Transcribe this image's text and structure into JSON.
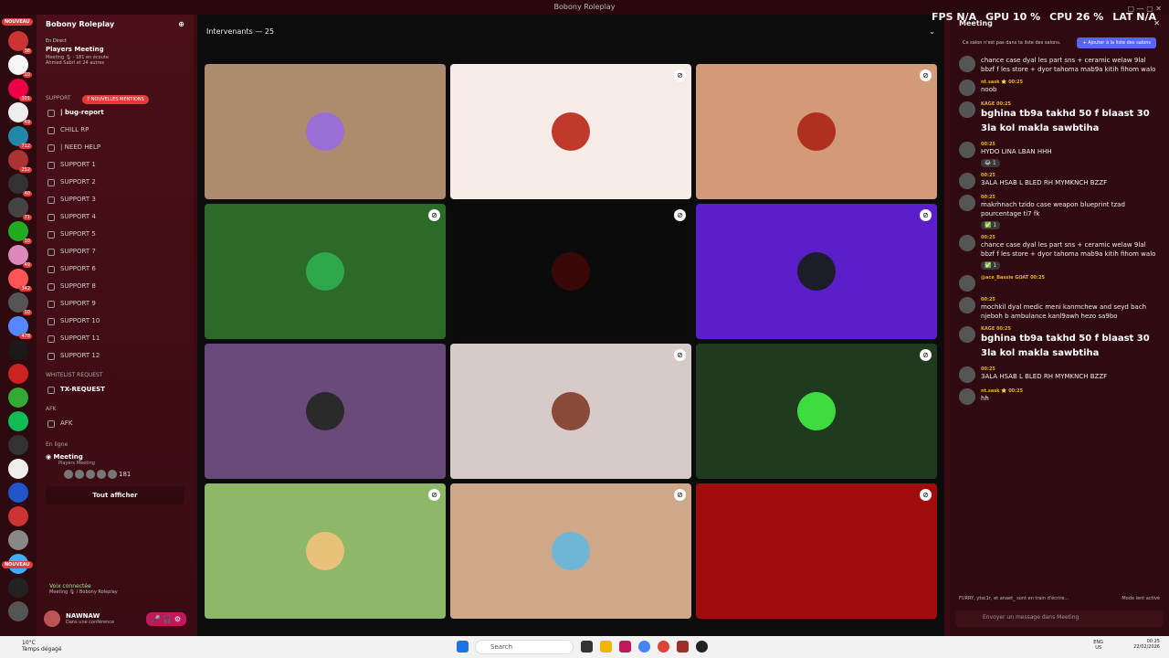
{
  "window": {
    "title": "Bobony Roleplay",
    "controls": "▢ — ▢ ✕"
  },
  "hud": {
    "fps_label": "FPS",
    "fps": "N/A",
    "gpu_label": "GPU",
    "gpu": "10 %",
    "cpu_label": "CPU",
    "cpu": "26 %",
    "lat_label": "LAT",
    "lat": "N/A"
  },
  "rail": {
    "nouveau_top": "NOUVEAU",
    "nouveau_bottom": "NOUVEAU",
    "badges": [
      "38",
      "10",
      "301",
      "49",
      "712",
      "252",
      "40",
      "71",
      "10",
      "49",
      "342",
      "10",
      "478"
    ]
  },
  "sidebar": {
    "server_name": "Bobony Roleplay",
    "event": {
      "live": "En Direct",
      "title": "Players Meeting",
      "meta": "Meeting 🎙 · 181 en écoute",
      "people": "Ahmed Sabri et 24 autres"
    },
    "mentions": "7 NOUVELLES MENTIONS",
    "support_cat": "SUPPORT",
    "channels": [
      {
        "name": "| bug-report",
        "bold": true
      },
      {
        "name": "CHILL RP",
        "bold": false
      },
      {
        "name": "| NEED HELP",
        "bold": false
      },
      {
        "name": "SUPPORT 1",
        "bold": false
      },
      {
        "name": "SUPPORT 2",
        "bold": false
      },
      {
        "name": "SUPPORT 3",
        "bold": false
      },
      {
        "name": "SUPPORT 4",
        "bold": false
      },
      {
        "name": "SUPPORT 5",
        "bold": false
      },
      {
        "name": "SUPPORT 7",
        "bold": false
      },
      {
        "name": "SUPPORT 6",
        "bold": false
      },
      {
        "name": "SUPPORT 8",
        "bold": false
      },
      {
        "name": "SUPPORT 9",
        "bold": false
      },
      {
        "name": "SUPPORT 10",
        "bold": false
      },
      {
        "name": "SUPPORT 11",
        "bold": false
      },
      {
        "name": "SUPPORT 12",
        "bold": false
      }
    ],
    "whitelist_cat": "WHITELIST REQUEST",
    "tx_request": "TX-REQUEST",
    "afk_cat": "AFK",
    "afk_channel": "AFK",
    "online_label": "En ligne",
    "meeting": "Meeting",
    "meeting_sub": "Players Meeting",
    "listeners": "181",
    "show_all": "Tout afficher",
    "voice_connected": "Voix connectée",
    "voice_sub": "Meeting 🎙 / Bobony Roleplay",
    "user_name": "NAWNAW",
    "user_status": "Dans une conférence"
  },
  "stage": {
    "header": "Intervenants — 25"
  },
  "tiles": [
    {
      "bg": "#ad8b6f",
      "avatar": "#9a6fd6",
      "mute": false
    },
    {
      "bg": "#f7ece8",
      "avatar": "#c0392b",
      "mute": true
    },
    {
      "bg": "#d39a7a",
      "avatar": "#b03020",
      "mute": true
    },
    {
      "bg": "#2d6a2a",
      "avatar": "#2ea64a",
      "mute": true
    },
    {
      "bg": "#0b0b0b",
      "avatar": "#3a0808",
      "mute": true
    },
    {
      "bg": "#5a1fc8",
      "avatar": "#1d1d2a",
      "mute": true
    },
    {
      "bg": "#6a4a7a",
      "avatar": "#2a2a2a",
      "mute": false
    },
    {
      "bg": "#d6cbc8",
      "avatar": "#8a4a3a",
      "mute": true
    },
    {
      "bg": "#1f3a1f",
      "avatar": "#3fdc3f",
      "mute": true
    },
    {
      "bg": "#8fb76a",
      "avatar": "#e8c27a",
      "mute": true
    },
    {
      "bg": "#cfa789",
      "avatar": "#6fb6d6",
      "mute": true
    },
    {
      "bg": "#a10d0d",
      "avatar": "#a10d0d",
      "mute": true
    }
  ],
  "chat": {
    "header": "Meeting",
    "notice": "Ce salon n'est pas dans ta liste des salons.",
    "notice_btn": "+ Ajouter à la liste des salons",
    "messages": [
      {
        "who": "",
        "text": "chance case dyal les part sns + ceramic welaw 9lal bbzf f les store + dyor tahoma mab9a kitih fihom walo",
        "big": false,
        "react": ""
      },
      {
        "who": "nt.sask ⭐ 00:25",
        "text": "noob",
        "big": false,
        "react": ""
      },
      {
        "who": "KAGE 00:25",
        "text": "bghina tb9a takhd 50 f blaast 30 3la kol makla sawbtiha",
        "big": true,
        "react": ""
      },
      {
        "who": "00:25",
        "text": "HYDO LINA LBAN HHH",
        "big": false,
        "react": "😂 1"
      },
      {
        "who": "00:25",
        "text": "3ALA HSAB L BLED RH MYMKNCH BZZF",
        "big": false,
        "react": ""
      },
      {
        "who": "00:25",
        "text": "makrhnach tzido case weapon blueprint tzad pourcentage ti7 fk",
        "big": false,
        "react": "✅ 1"
      },
      {
        "who": "00:25",
        "text": "chance case dyal les part sns + ceramic welaw 9lal bbzf f les store + dyor tahoma mab9a kitih fihom walo",
        "big": false,
        "react": "✅ 1"
      },
      {
        "who": "@ace_Bassie GOAT 00:25",
        "text": "",
        "big": false,
        "react": ""
      },
      {
        "who": "00:25",
        "text": "mochkil dyal medic meni kanmchew and seyd bach njeboh b ambulance kanl9awh hezo sa9bo",
        "big": false,
        "react": ""
      },
      {
        "who": "KAGE 00:25",
        "text": "bghina tb9a takhd 50 f blaast 30 3la kol makla sawbtiha",
        "big": true,
        "react": ""
      },
      {
        "who": "00:25",
        "text": "3ALA HSAB L BLED RH MYMKNCH BZZF",
        "big": false,
        "react": ""
      },
      {
        "who": "nt.sask ⭐ 00:25",
        "text": "hh",
        "big": false,
        "react": ""
      }
    ],
    "typing": "FURRY, ytsc1r, et anaet_ sont en train d'écrire...",
    "slow_mode": "Mode lent activé",
    "input_placeholder": "Envoyer un message dans Meeting"
  },
  "taskbar": {
    "temp": "10°C",
    "weather": "Temps dégagé",
    "search": "Search",
    "lang1": "ENG",
    "lang2": "US",
    "time": "00:25",
    "date": "22/02/2026"
  }
}
